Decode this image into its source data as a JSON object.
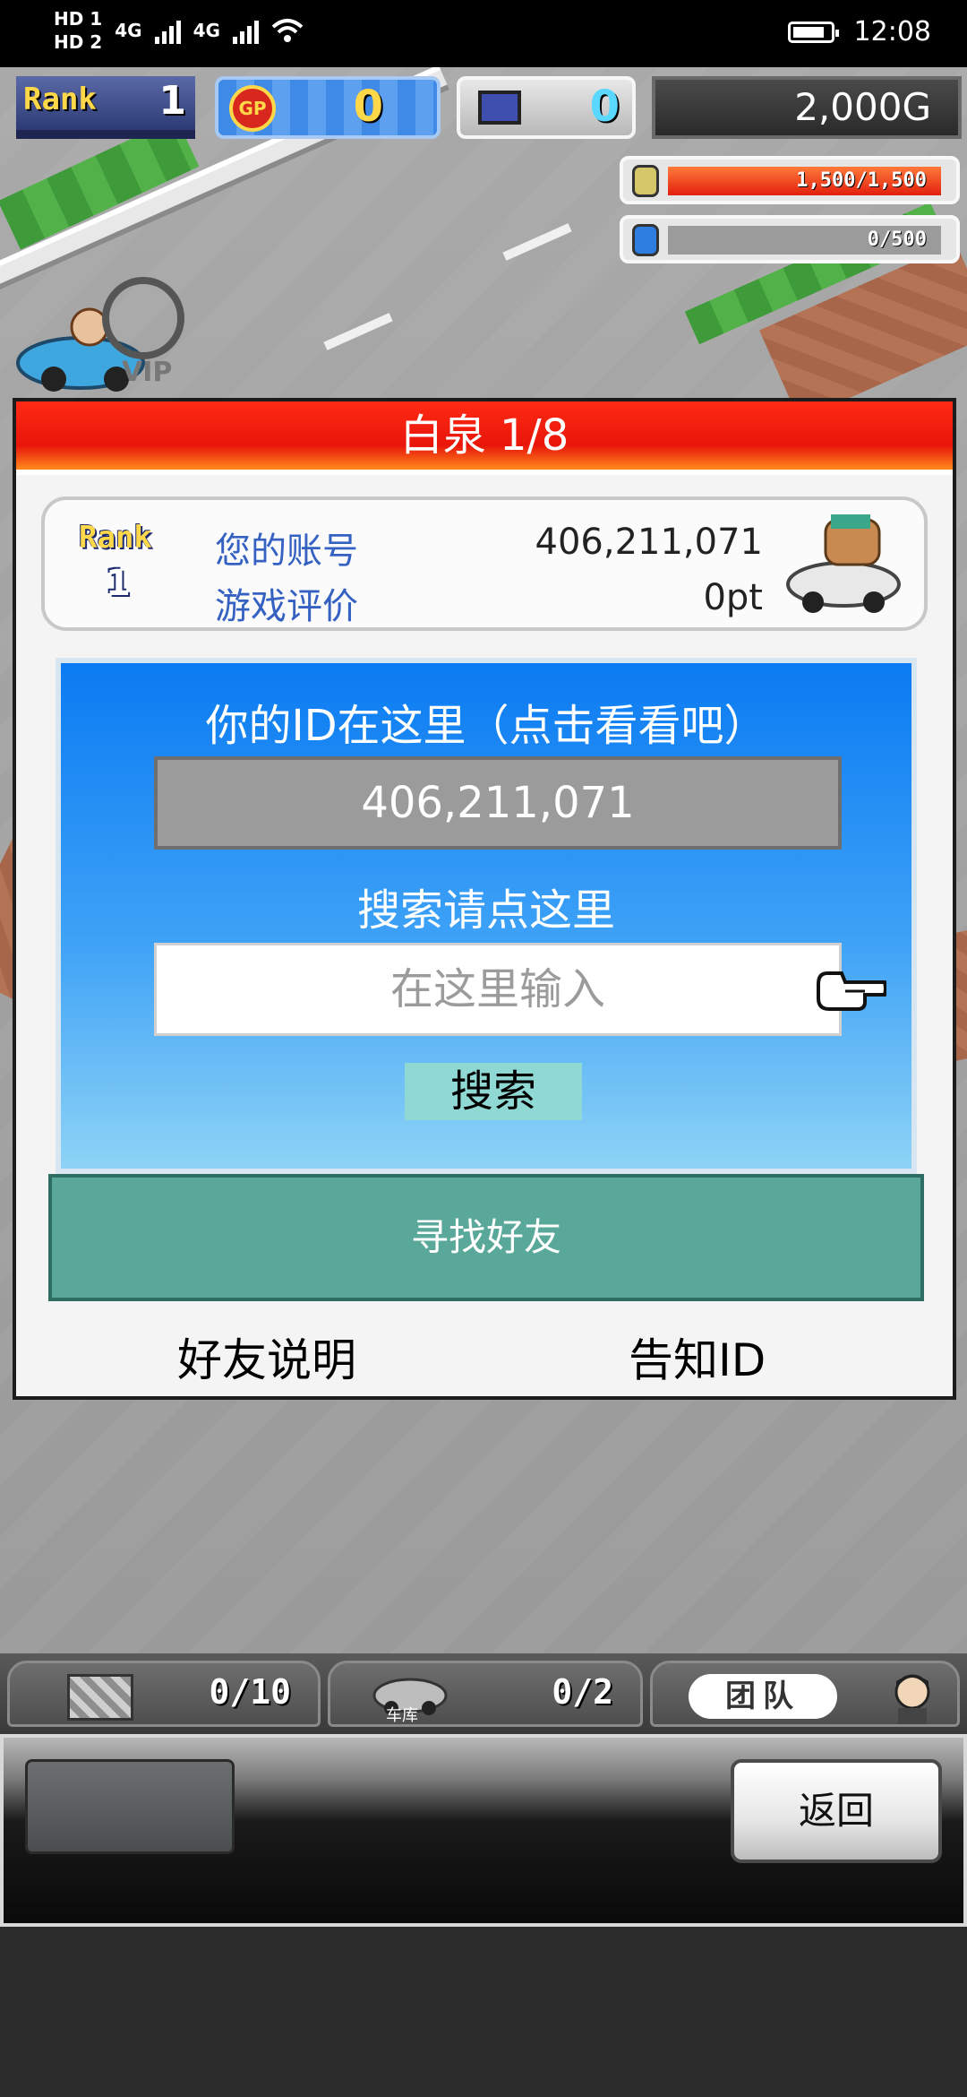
{
  "status_bar": {
    "left_label_1": "HD 1",
    "left_label_2": "HD 2",
    "network_1": "4G",
    "network_2": "4G",
    "time": "12:08"
  },
  "hud": {
    "rank_label": "Rank",
    "rank_value": "1",
    "gp_label": "GP",
    "gp_value": "0",
    "pc_value": "0",
    "money": "2,000G",
    "fuel_bar_text": "1,500/1,500",
    "fuel_fill_fraction": 1.0,
    "water_bar_text": "0/500",
    "water_fill_fraction": 0.0
  },
  "dialog": {
    "title": "白泉 1/8",
    "info": {
      "rank_label": "Rank",
      "rank_value": "1",
      "account_label": "您的账号",
      "account_value": "406,211,071",
      "rating_label": "游戏评价",
      "rating_value": "0pt"
    },
    "id_panel": {
      "title": "你的ID在这里（点击看看吧）",
      "id_value": "406,211,071",
      "search_label": "搜索请点这里",
      "search_placeholder": "在这里输入",
      "search_button": "搜索"
    },
    "find_friend_button": "寻找好友",
    "friend_help_link": "好友说明",
    "share_id_link": "告知ID"
  },
  "bottom_hud": {
    "items_count": "0/10",
    "garage_label": "车库",
    "garage_count": "0/2",
    "team_button": "团队"
  },
  "bottom_bar": {
    "back_button": "返回"
  },
  "colors": {
    "title_red": "#e8160a",
    "panel_blue": "#0b7bf2",
    "friend_green": "#5aa89a",
    "search_btn": "#8fd8d4"
  }
}
